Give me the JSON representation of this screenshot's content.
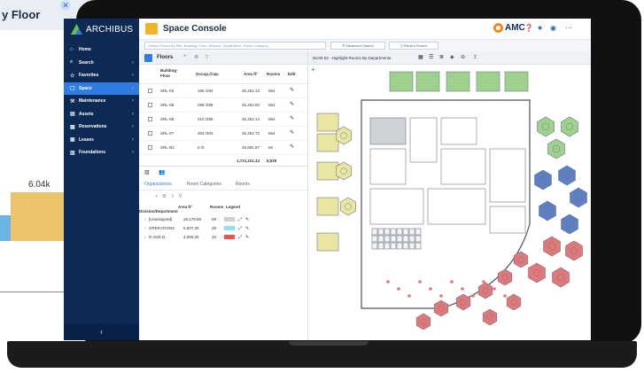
{
  "background_chart": {
    "title": "y Floor",
    "close_icon": "close-icon",
    "bar_value_label": "6.04k",
    "bar_color": "#eac36a",
    "side_bar_color": "#6cb4e4"
  },
  "app": {
    "brand": "ARCHIBUS",
    "title": "Space Console",
    "org_brand": "AMC",
    "colors": {
      "nav": "#0c2a54",
      "active_nav": "#2f7de0",
      "accent": "#f0b429",
      "brand_ring": "#f08a24"
    }
  },
  "nav": {
    "items": [
      {
        "icon": "home-icon",
        "label": "Home",
        "has_children": false
      },
      {
        "icon": "search-icon",
        "label": "Search",
        "has_children": true
      },
      {
        "icon": "star-icon",
        "label": "Favorites",
        "has_children": true
      },
      {
        "icon": "space-icon",
        "label": "Space",
        "has_children": true,
        "active": true
      },
      {
        "icon": "wrench-icon",
        "label": "Maintenance",
        "has_children": true
      },
      {
        "icon": "assets-icon",
        "label": "Assets",
        "has_children": true
      },
      {
        "icon": "calendar-icon",
        "label": "Reservations",
        "has_children": true
      },
      {
        "icon": "leases-icon",
        "label": "Leases",
        "has_children": true
      },
      {
        "icon": "foundations-icon",
        "label": "Foundations",
        "has_children": true
      }
    ],
    "collapse_label": "‹"
  },
  "header_icons": [
    "help-icon",
    "favorite-star-icon",
    "user-icon",
    "more-icon"
  ],
  "search": {
    "placeholder": "Search Floors By Site, Building, Floor, Division, Department, Room Category",
    "advanced_label": "Advanced Search",
    "recent_label": "Recent Search"
  },
  "floors": {
    "label": "Floors",
    "columns": [
      "Building-Floor",
      "Occup./Cap.",
      "Area ft²",
      "Rooms",
      "Edit"
    ],
    "rows": [
      {
        "floor": "SRL-04",
        "occup": "166 /294",
        "area": "46,264.13",
        "rooms": "564"
      },
      {
        "floor": "SRL-05",
        "occup": "298 /298",
        "area": "46,264.50",
        "rooms": "564"
      },
      {
        "floor": "SRL-06",
        "occup": "210 /295",
        "area": "46,264.14",
        "rooms": "564"
      },
      {
        "floor": "SRL-07",
        "occup": "303 /303",
        "area": "46,264.72",
        "rooms": "564"
      },
      {
        "floor": "SRL-B1",
        "occup": "0 /0",
        "area": "46,891.87",
        "rooms": "66"
      }
    ],
    "total_area": "1,721,101.12",
    "total_rooms": "8,529"
  },
  "lower_panel": {
    "tabs": [
      "Organizations",
      "Room Categories",
      "Rooms"
    ],
    "active_tab": "Organizations",
    "columns": [
      "Division/Department",
      "Area ft²",
      "Rooms",
      "Legend"
    ],
    "rows": [
      {
        "name": "[Unassigned]",
        "area": "26,179.89",
        "rooms": "69",
        "color": "#cfcfcf"
      },
      {
        "name": "OPERATIONS",
        "area": "6,607.25",
        "rooms": "29",
        "color": "#8ee3f0"
      },
      {
        "name": "R AND D",
        "area": "4,590.25",
        "rooms": "33",
        "color": "#e4574c"
      }
    ]
  },
  "plan": {
    "title": "NC05 02 - Highlight Rooms By Departments",
    "colors": {
      "green": "#9fd18e",
      "yellow": "#e9e6a3",
      "blue": "#5d7fc4",
      "red": "#e0787a",
      "gray": "#cfd3d8"
    }
  }
}
